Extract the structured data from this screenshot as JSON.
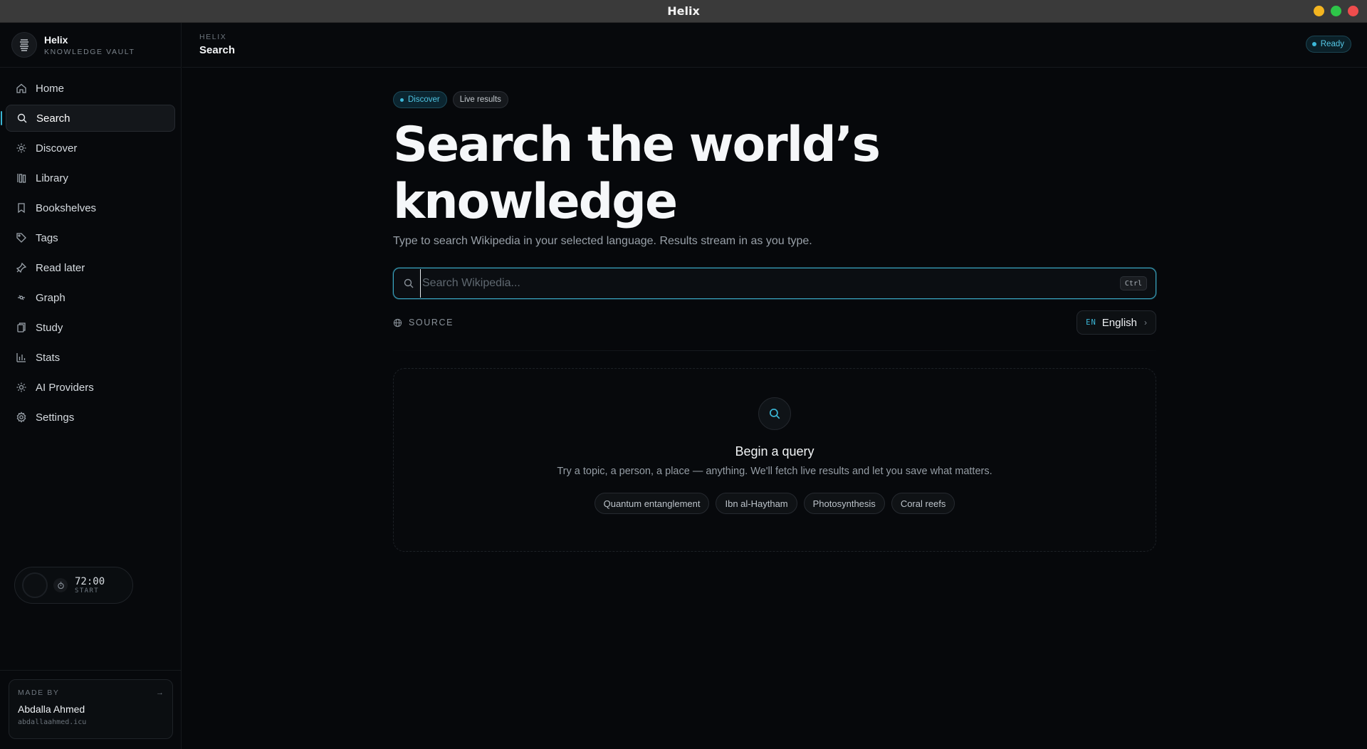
{
  "window": {
    "title": "Helix"
  },
  "brand": {
    "name": "Helix",
    "subtitle": "KNOWLEDGE VAULT"
  },
  "sidebar": {
    "items": [
      {
        "label": "Home",
        "icon": "home-icon"
      },
      {
        "label": "Search",
        "icon": "search-icon",
        "active": true
      },
      {
        "label": "Discover",
        "icon": "compass-icon"
      },
      {
        "label": "Library",
        "icon": "library-icon"
      },
      {
        "label": "Bookshelves",
        "icon": "bookmark-icon"
      },
      {
        "label": "Tags",
        "icon": "tag-icon"
      },
      {
        "label": "Read later",
        "icon": "pin-icon"
      },
      {
        "label": "Graph",
        "icon": "graph-icon"
      },
      {
        "label": "Study",
        "icon": "cards-icon"
      },
      {
        "label": "Stats",
        "icon": "bar-chart-icon"
      },
      {
        "label": "AI Providers",
        "icon": "sparkle-icon"
      },
      {
        "label": "Settings",
        "icon": "gear-icon"
      }
    ]
  },
  "timer": {
    "time": "72:00",
    "label": "START"
  },
  "madeby": {
    "label": "MADE BY",
    "arrow": "→",
    "name": "Abdalla Ahmed",
    "url": "abdallaahmed.icu"
  },
  "header": {
    "crumb": "HELIX",
    "title": "Search",
    "status": "Ready"
  },
  "main": {
    "chips": {
      "discover": "Discover",
      "live": "Live results"
    },
    "hero": "Search the world’s knowledge",
    "subtitle": "Type to search Wikipedia in your selected language. Results stream in as you type.",
    "search": {
      "value": "",
      "placeholder": "Search Wikipedia...",
      "shortcut": "Ctrl"
    },
    "source": {
      "label": "SOURCE",
      "lang_code": "EN",
      "lang_name": "English",
      "chevron": "›"
    },
    "empty": {
      "title": "Begin a query",
      "description": "Try a topic, a person, a place — anything. We'll fetch live results and let you save what matters.",
      "suggestions": [
        "Quantum entanglement",
        "Ibn al-Haytham",
        "Photosynthesis",
        "Coral reefs"
      ]
    }
  },
  "colors": {
    "accent": "#3cb8d8",
    "background": "#06080b",
    "sidebar": "#07090c",
    "border": "#16191d"
  }
}
